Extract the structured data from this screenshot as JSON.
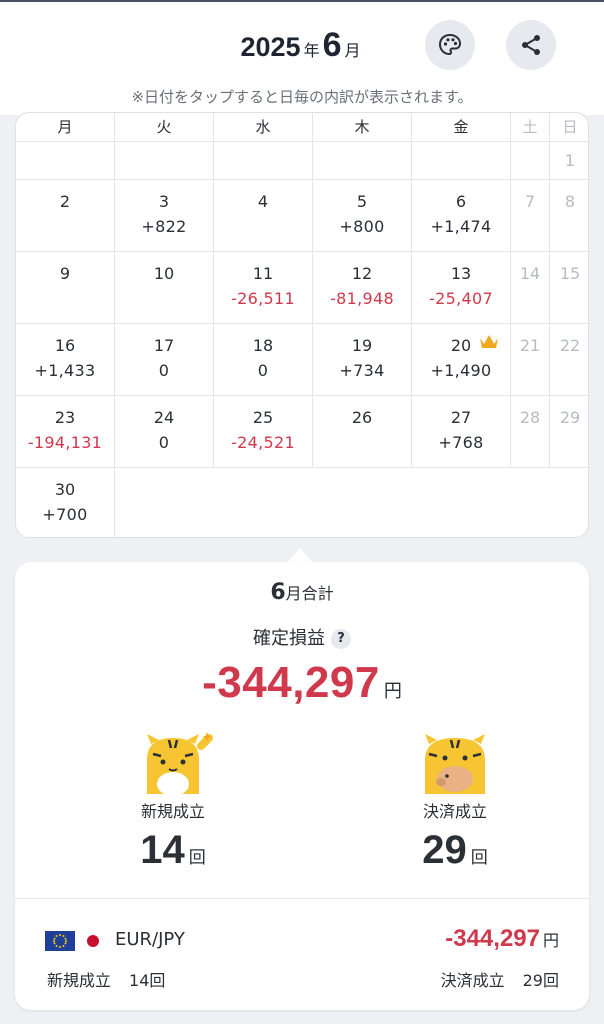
{
  "header": {
    "year": "2025",
    "year_unit": "年",
    "month": "6",
    "month_unit": "月",
    "hint": "※日付をタップすると日毎の内訳が表示されます。",
    "palette_icon": "palette-icon",
    "share_icon": "share-icon"
  },
  "calendar": {
    "weekdays": [
      "月",
      "火",
      "水",
      "木",
      "金",
      "土",
      "日"
    ],
    "weeks": [
      [
        {
          "day": "",
          "pl": ""
        },
        {
          "day": "",
          "pl": ""
        },
        {
          "day": "",
          "pl": ""
        },
        {
          "day": "",
          "pl": ""
        },
        {
          "day": "",
          "pl": ""
        },
        {
          "day": "",
          "pl": ""
        },
        {
          "day": "1",
          "pl": ""
        }
      ],
      [
        {
          "day": "2",
          "pl": ""
        },
        {
          "day": "3",
          "pl": "+822"
        },
        {
          "day": "4",
          "pl": ""
        },
        {
          "day": "5",
          "pl": "+800"
        },
        {
          "day": "6",
          "pl": "+1,474"
        },
        {
          "day": "7",
          "pl": ""
        },
        {
          "day": "8",
          "pl": ""
        }
      ],
      [
        {
          "day": "9",
          "pl": ""
        },
        {
          "day": "10",
          "pl": ""
        },
        {
          "day": "11",
          "pl": "-26,511"
        },
        {
          "day": "12",
          "pl": "-81,948"
        },
        {
          "day": "13",
          "pl": "-25,407"
        },
        {
          "day": "14",
          "pl": ""
        },
        {
          "day": "15",
          "pl": ""
        }
      ],
      [
        {
          "day": "16",
          "pl": "+1,433"
        },
        {
          "day": "17",
          "pl": "0"
        },
        {
          "day": "18",
          "pl": "0"
        },
        {
          "day": "19",
          "pl": "+734"
        },
        {
          "day": "20",
          "pl": "+1,490"
        },
        {
          "day": "21",
          "pl": ""
        },
        {
          "day": "22",
          "pl": ""
        }
      ],
      [
        {
          "day": "23",
          "pl": "-194,131"
        },
        {
          "day": "24",
          "pl": "0"
        },
        {
          "day": "25",
          "pl": "-24,521"
        },
        {
          "day": "26",
          "pl": ""
        },
        {
          "day": "27",
          "pl": "+768"
        },
        {
          "day": "28",
          "pl": ""
        },
        {
          "day": "29",
          "pl": ""
        }
      ],
      [
        {
          "day": "30",
          "pl": "+700"
        }
      ]
    ],
    "crown_icon": "crown-icon",
    "colors": {
      "negative": "#d0384c",
      "positive": "#2b2f36",
      "weekend": "#b7bcc3",
      "crown": "#f2a81d"
    }
  },
  "summary": {
    "month": "6",
    "title": "月合計",
    "pl_label": "確定損益",
    "help": "?",
    "total_pl": "-344,297",
    "yen": "円",
    "new_label": "新規成立",
    "new_count": "14",
    "close_label": "決済成立",
    "close_count": "29",
    "count_unit": "回",
    "mascot_new_icon": "tiger-mascot-sparkle-icon",
    "mascot_close_icon": "tiger-mascot-piggybank-icon"
  },
  "pair": {
    "name": "EUR/JPY",
    "flag_base_icon": "eu-flag-icon",
    "flag_quote_icon": "japan-flag-icon",
    "pl": "-344,297",
    "yen": "円",
    "new_label": "新規成立",
    "new_count": "14回",
    "close_label": "決済成立",
    "close_count": "29回"
  }
}
